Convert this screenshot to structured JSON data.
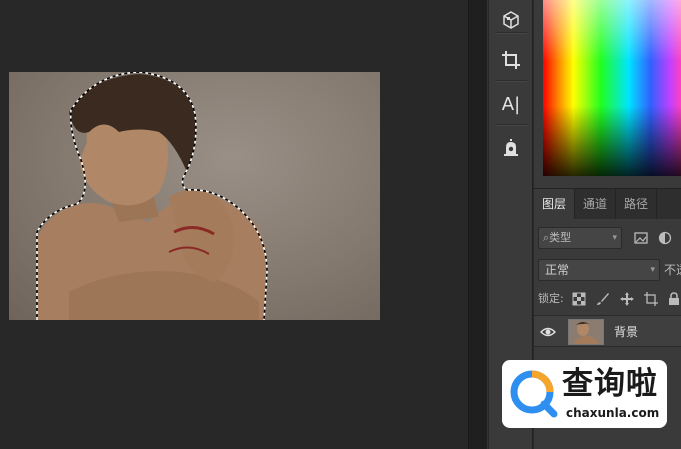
{
  "app": "Photoshop",
  "document": {
    "layer_thumbnail": "portrait-photo",
    "selection": "marching-ants-outline"
  },
  "tools": [
    {
      "name": "3d-material-tool",
      "icon": "cube-icon"
    },
    {
      "name": "crop-tool",
      "icon": "crop-icon"
    },
    {
      "name": "character-tool",
      "icon": "type-icon",
      "label": "A|"
    },
    {
      "name": "properties-tool",
      "icon": "alarm-icon"
    }
  ],
  "layers_panel": {
    "tabs": [
      {
        "label": "图层",
        "active": true
      },
      {
        "label": "通道",
        "active": false
      },
      {
        "label": "路径",
        "active": false
      }
    ],
    "filter": {
      "placeholder": "类型",
      "icon": "search-icon"
    },
    "blend_mode": "正常",
    "opacity_label": "不透",
    "lock_label": "锁定:",
    "layers": [
      {
        "name": "背景",
        "visible": true
      }
    ]
  },
  "watermark": {
    "title": "查询啦",
    "domain": "chaxunla.com"
  },
  "colors": {
    "workspace": "#282828",
    "panel": "#3a3a3a",
    "accent_blue": "#2f8ff0",
    "accent_orange": "#f5a52a"
  }
}
